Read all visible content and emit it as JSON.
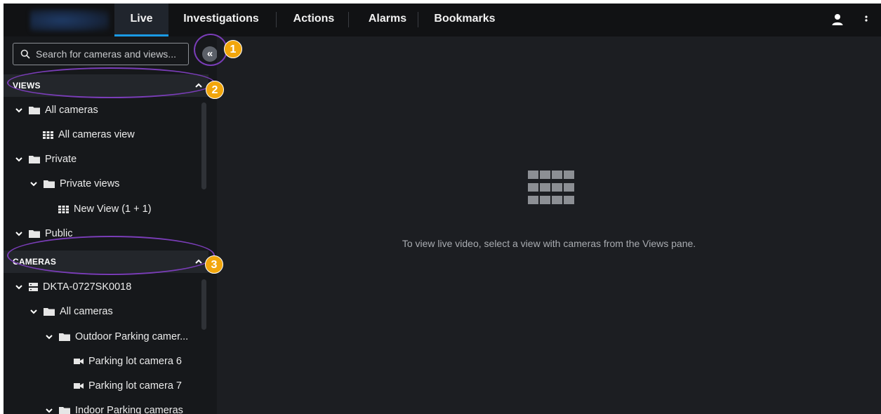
{
  "nav": {
    "tabs": [
      {
        "label": "Live",
        "active": true
      },
      {
        "label": "Investigations",
        "active": false
      },
      {
        "label": "Actions",
        "active": false
      },
      {
        "label": "Alarms",
        "active": false
      },
      {
        "label": "Bookmarks",
        "active": false
      }
    ],
    "icons": {
      "user": "user-icon",
      "more": "more-vertical-icon"
    }
  },
  "search": {
    "placeholder": "Search for cameras and views..."
  },
  "views": {
    "header": "VIEWS",
    "items": [
      {
        "label": "All cameras",
        "icon": "folder-icon"
      },
      {
        "label": "All cameras view",
        "icon": "grid-view-icon"
      },
      {
        "label": "Private",
        "icon": "folder-icon"
      },
      {
        "label": "Private views",
        "icon": "folder-icon"
      },
      {
        "label": "New View (1 + 1)",
        "icon": "grid-view-icon"
      },
      {
        "label": "Public",
        "icon": "folder-icon"
      }
    ]
  },
  "cameras": {
    "header": "CAMERAS",
    "items": [
      {
        "label": "DKTA-0727SK0018",
        "icon": "server-icon"
      },
      {
        "label": "All cameras",
        "icon": "folder-icon"
      },
      {
        "label": "Outdoor Parking camer...",
        "icon": "folder-icon"
      },
      {
        "label": "Parking lot camera 6",
        "icon": "camera-icon"
      },
      {
        "label": "Parking lot camera 7",
        "icon": "camera-icon"
      },
      {
        "label": "Indoor Parking cameras",
        "icon": "folder-icon"
      }
    ]
  },
  "main": {
    "empty_message": "To view live video, select a view with cameras from the Views pane."
  },
  "callouts": [
    "1",
    "2",
    "3"
  ],
  "colors": {
    "accent": "#1a9be6",
    "callout": "#f2a60c",
    "ring": "#7a3db8"
  }
}
